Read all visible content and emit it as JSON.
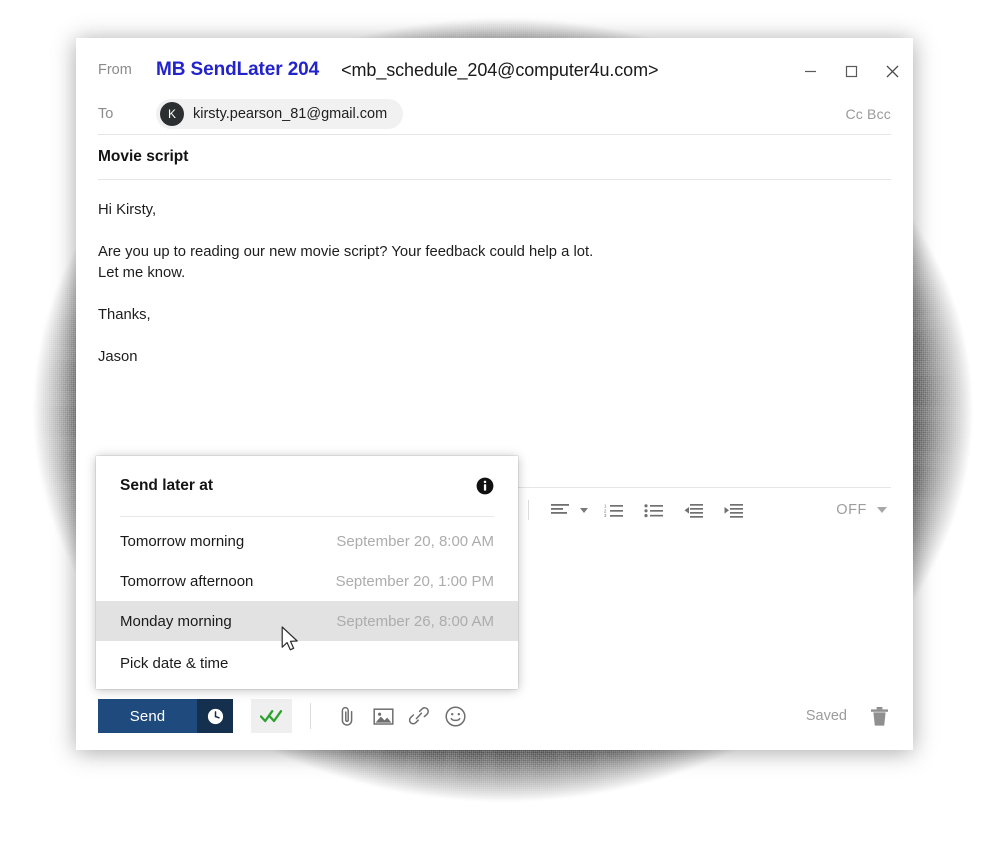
{
  "window": {
    "controls": {
      "minimize": "minimize-window",
      "maximize": "maximize-window",
      "close": "close-window"
    }
  },
  "header": {
    "from_label": "From",
    "from_name": "MB SendLater 204",
    "from_email": "<mb_schedule_204@computer4u.com>",
    "from_name_color": "#2323cc",
    "to_label": "To",
    "recipient_initial": "K",
    "recipient_email": "kirsty.pearson_81@gmail.com",
    "cc_bcc": "Cc Bcc",
    "subject": "Movie script"
  },
  "body": {
    "lines": [
      "Hi Kirsty,",
      "",
      "Are you up to reading our new movie script? Your feedback could help a lot.",
      "Let me know.",
      "",
      "Thanks,",
      "",
      "Jason"
    ]
  },
  "send_later_menu": {
    "title": "Send later at",
    "info_icon": "info-icon",
    "items": [
      {
        "label": "Tomorrow morning",
        "date": "September 20, 8:00 AM",
        "highlighted": false
      },
      {
        "label": "Tomorrow afternoon",
        "date": "September 20, 1:00 PM",
        "highlighted": false
      },
      {
        "label": "Monday morning",
        "date": "September 26, 8:00 AM",
        "highlighted": true
      },
      {
        "label": "Pick date & time",
        "date": "",
        "highlighted": false
      }
    ]
  },
  "format_toolbar": {
    "align_icon": "text-align-left-icon",
    "align_caret_icon": "chevron-down-icon",
    "numbered_list_icon": "numbered-list-icon",
    "bulleted_list_icon": "bulleted-list-icon",
    "outdent_icon": "decrease-indent-icon",
    "indent_icon": "increase-indent-icon",
    "off_label": "OFF",
    "off_caret_icon": "chevron-down-icon"
  },
  "action_bar": {
    "send_label": "Send",
    "send_schedule_icon": "clock-icon",
    "send_button_color": "#1f4a7d",
    "send_schedule_color": "#15304f",
    "tracking_icon": "double-check-icon",
    "tracking_icon_color": "#2ca12c",
    "attach_icon": "paperclip-icon",
    "image_icon": "image-icon",
    "link_icon": "link-icon",
    "emoji_icon": "emoji-smiley-icon",
    "saved_label": "Saved",
    "delete_icon": "trash-icon"
  }
}
